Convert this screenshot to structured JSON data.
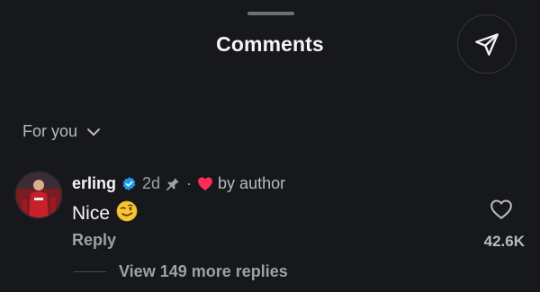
{
  "sheet": {
    "title": "Comments"
  },
  "icons": {
    "share": "paper-plane-icon",
    "filter_chevron": "chevron-down-icon",
    "verified": "verified-badge-icon",
    "pin": "pin-icon",
    "author_heart": "heart-filled-icon",
    "like": "heart-outline-icon",
    "emoji": "winking-face-emoji"
  },
  "filter": {
    "label": "For you"
  },
  "comment": {
    "username": "erling",
    "time": "2d",
    "separator": "·",
    "liked_by": "by author",
    "text": "Nice",
    "reply_label": "Reply",
    "like_count": "42.6K",
    "view_replies": "View 149 more replies"
  },
  "colors": {
    "background": "#17181c",
    "verified_blue": "#1d9bf0",
    "author_heart_red": "#ff2d55",
    "muted_text": "#9ea0a6"
  }
}
